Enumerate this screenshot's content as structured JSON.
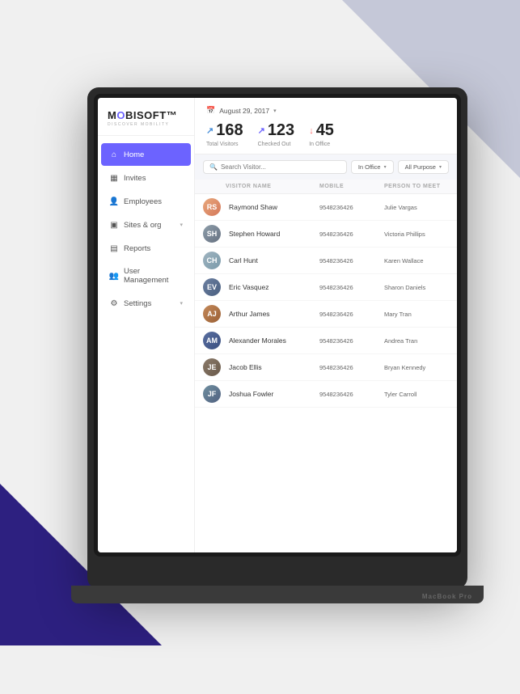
{
  "background": {
    "triangle_top_color": "#c5c8d8",
    "triangle_bottom_color": "#2d2080"
  },
  "laptop": {
    "camera_label": "MacBook Pro"
  },
  "logo": {
    "text": "MOBISOFT",
    "trademark": "™",
    "subtitle": "DISCOVER MOBILITY"
  },
  "sidebar": {
    "items": [
      {
        "id": "home",
        "label": "Home",
        "icon": "🏠",
        "active": true
      },
      {
        "id": "invites",
        "label": "Invites",
        "icon": "📅",
        "active": false
      },
      {
        "id": "employees",
        "label": "Employees",
        "icon": "👤",
        "active": false
      },
      {
        "id": "sites-org",
        "label": "Sites & org",
        "icon": "🏢",
        "active": false,
        "hasChevron": true
      },
      {
        "id": "reports",
        "label": "Reports",
        "icon": "📋",
        "active": false
      },
      {
        "id": "user-management",
        "label": "User Management",
        "icon": "👥",
        "active": false
      },
      {
        "id": "settings",
        "label": "Settings",
        "icon": "⚙️",
        "active": false,
        "hasChevron": true
      }
    ]
  },
  "header": {
    "date": "August 29, 2017",
    "date_icon": "📅"
  },
  "stats": [
    {
      "id": "total-visitors",
      "value": "168",
      "label": "Total Visitors",
      "arrow": "↗",
      "arrow_class": "blue"
    },
    {
      "id": "checked-out",
      "value": "123",
      "label": "Checked Out",
      "arrow": "↗",
      "arrow_class": "up"
    },
    {
      "id": "in-office",
      "value": "45",
      "label": "In Office",
      "arrow": "↓",
      "arrow_class": "down"
    }
  ],
  "filters": {
    "search_placeholder": "Search Visitor...",
    "filter1": "In Office",
    "filter2": "All Purpose"
  },
  "table": {
    "columns": [
      "",
      "VISITOR NAME",
      "MOBILE",
      "PERSON TO MEET"
    ],
    "rows": [
      {
        "id": 1,
        "name": "Raymond Shaw",
        "mobile": "9548236426",
        "person": "Julie Vargas",
        "initials": "RS",
        "avatar_class": "av-1"
      },
      {
        "id": 2,
        "name": "Stephen Howard",
        "mobile": "9548236426",
        "person": "Victoria Phillips",
        "initials": "SH",
        "avatar_class": "av-2"
      },
      {
        "id": 3,
        "name": "Carl Hunt",
        "mobile": "9548236426",
        "person": "Karen Wallace",
        "initials": "CH",
        "avatar_class": "av-3"
      },
      {
        "id": 4,
        "name": "Eric Vasquez",
        "mobile": "9548236426",
        "person": "Sharon Daniels",
        "initials": "EV",
        "avatar_class": "av-4"
      },
      {
        "id": 5,
        "name": "Arthur James",
        "mobile": "9548236426",
        "person": "Mary Tran",
        "initials": "AJ",
        "avatar_class": "av-5"
      },
      {
        "id": 6,
        "name": "Alexander Morales",
        "mobile": "9548236426",
        "person": "Andrea Tran",
        "initials": "AM",
        "avatar_class": "av-6"
      },
      {
        "id": 7,
        "name": "Jacob Ellis",
        "mobile": "9548236426",
        "person": "Bryan Kennedy",
        "initials": "JE",
        "avatar_class": "av-7"
      },
      {
        "id": 8,
        "name": "Joshua Fowler",
        "mobile": "9548236426",
        "person": "Tyler Carroll",
        "initials": "JF",
        "avatar_class": "av-8"
      }
    ]
  }
}
